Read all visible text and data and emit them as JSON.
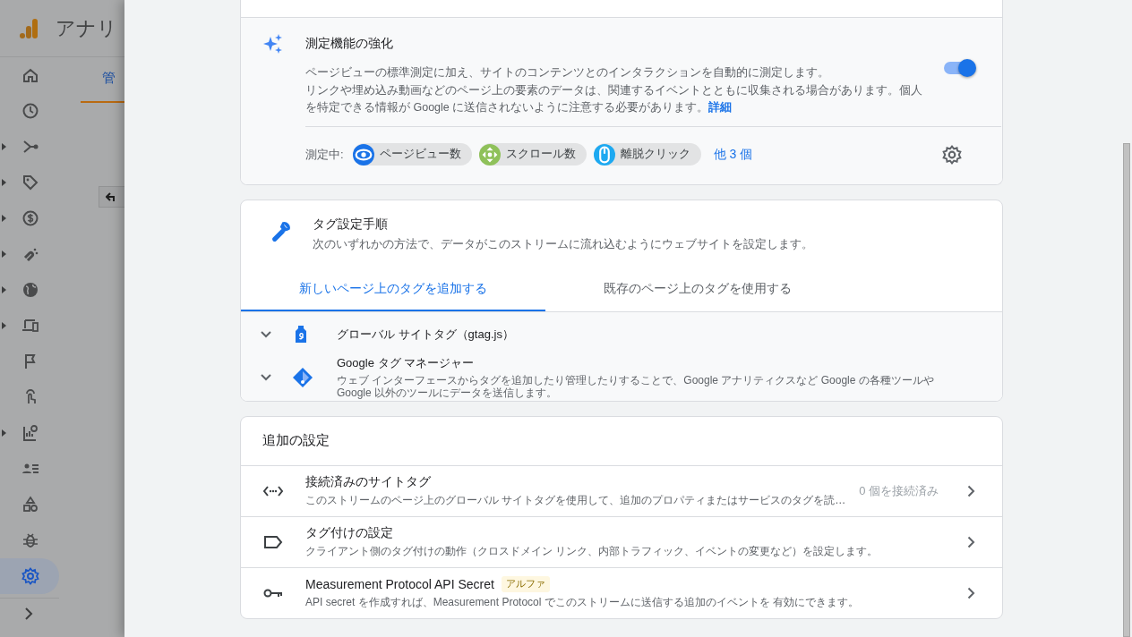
{
  "background_app": {
    "title": "アナリ",
    "tab": "管",
    "nav_items": [
      {
        "expandable": false,
        "selected": false
      },
      {
        "expandable": false,
        "selected": false
      },
      {
        "expandable": true,
        "selected": false
      },
      {
        "expandable": true,
        "selected": false
      },
      {
        "expandable": true,
        "selected": false
      },
      {
        "expandable": true,
        "selected": false
      },
      {
        "expandable": true,
        "selected": false
      },
      {
        "expandable": true,
        "selected": false
      },
      {
        "expandable": false,
        "selected": false
      },
      {
        "expandable": false,
        "selected": false
      },
      {
        "expandable": true,
        "selected": false
      },
      {
        "expandable": false,
        "selected": false
      },
      {
        "expandable": false,
        "selected": false
      },
      {
        "expandable": false,
        "selected": false
      },
      {
        "expandable": false,
        "selected": true
      }
    ]
  },
  "enhanced_measurement": {
    "title": "測定機能の強化",
    "description": [
      "ページビューの標準測定に加え、サイトのコンテンツとのインタラクションを自動的に測定します。",
      "リンクや埋め込み動画などのページ上の要素のデータは、関連するイベントとともに収集される場合があります。個人を特定できる情報が Google に送信されないように注意する必要があります。"
    ],
    "details_link": "詳細",
    "toggle": {
      "on": true
    },
    "measuring_label": "測定中:",
    "chips": [
      {
        "label": "ページビュー数",
        "color": "#1a73e8"
      },
      {
        "label": "スクロール数",
        "color": "#8fc15a"
      },
      {
        "label": "離脱クリック",
        "color": "#1da9f1"
      }
    ],
    "more_link": "他 3 個"
  },
  "tagging": {
    "title": "タグ設定手順",
    "subtitle": "次のいずれかの方法で、データがこのストリームに流れ込むようにウェブサイトを設定します。",
    "tabs": [
      {
        "label": "新しいページ上のタグを追加する",
        "selected": true
      },
      {
        "label": "既存のページ上のタグを使用する",
        "selected": false
      }
    ],
    "methods": [
      {
        "title": "グローバル サイトタグ（gtag.js）",
        "expanded": false
      },
      {
        "title": "Google タグ マネージャー",
        "description": "ウェブ インターフェースからタグを追加したり管理したりすることで、Google アナリティクスなど Google の各種ツールや Google 以外のツールにデータを送信します。",
        "expanded": false
      }
    ]
  },
  "additional_settings": {
    "title": "追加の設定",
    "rows": [
      {
        "title": "接続済みのサイトタグ",
        "description": "このストリームのページ上のグローバル サイトタグを使用して、追加のプロパティまたはサービスのタグを読…",
        "status": "0 個を接続済み"
      },
      {
        "title": "タグ付けの設定",
        "description": "クライアント側のタグ付けの動作（クロスドメイン リンク、内部トラフィック、イベントの変更など）を設定します。"
      },
      {
        "title": "Measurement Protocol API Secret",
        "badge": "アルファ",
        "description": "API secret を作成すれば、Measurement Protocol でこのストリームに送信する追加のイベントを 有効にできます。"
      }
    ]
  }
}
